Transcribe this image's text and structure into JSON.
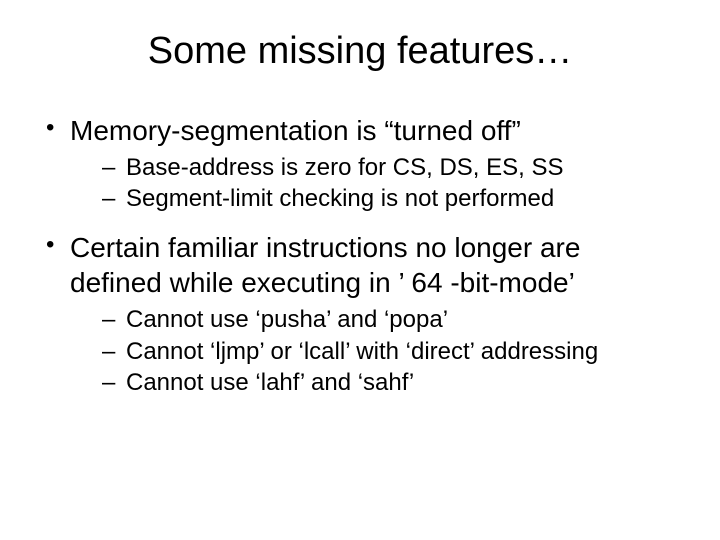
{
  "title": "Some missing features…",
  "bullets": [
    {
      "text": "Memory-segmentation is “turned off”",
      "sub": [
        "Base-address is zero for CS, DS, ES, SS",
        "Segment-limit checking is not performed"
      ]
    },
    {
      "text": "Certain familiar instructions no longer are defined while executing in ’ 64 -bit-mode’",
      "sub": [
        "Cannot use ‘pusha’ and ‘popa’",
        "Cannot ‘ljmp’ or ‘lcall’ with ‘direct’ addressing",
        "Cannot use ‘lahf’ and ‘sahf’"
      ]
    }
  ]
}
